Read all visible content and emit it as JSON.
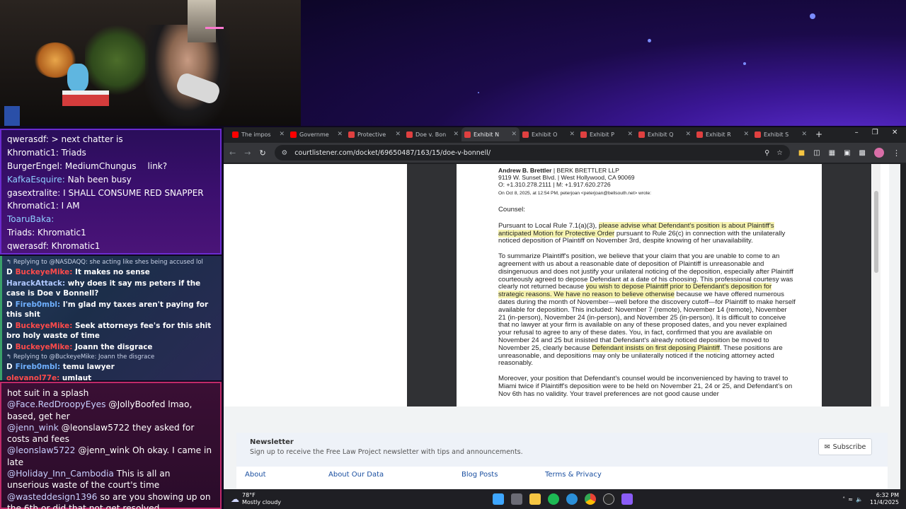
{
  "chat1": {
    "lines": [
      {
        "user": "qwerasdf",
        "text": "> next chatter is",
        "ucolor": "#ffffff"
      },
      {
        "user": "Khromatic1",
        "text": "Triads",
        "ucolor": "#ffffff"
      },
      {
        "user": "BurgerEngel",
        "text": "MediumChungus",
        "extra": "link?",
        "ucolor": "#ffffff"
      },
      {
        "user": "KafkaEsquire",
        "text": "Nah been busy",
        "ucolor": "#8fd0ff"
      },
      {
        "user": "gasextralite",
        "text": "I SHALL CONSUME RED SNAPPER",
        "ucolor": "#ffffff"
      },
      {
        "user": "Khromatic1",
        "text": "I AM",
        "ucolor": "#ffffff"
      },
      {
        "user": "ToaruBaka",
        "text": "",
        "ucolor": "#8fd0ff"
      },
      {
        "user": "Triads",
        "text": "Khromatic1",
        "ucolor": "#ffffff"
      },
      {
        "user": "qwerasdf",
        "text": "Khromatic1",
        "ucolor": "#ffffff"
      }
    ]
  },
  "chat2": {
    "items": [
      {
        "kind": "reply",
        "text": "Replying to @NASDAQQ: she acting like shes being accused lol"
      },
      {
        "kind": "msg",
        "badge": "D",
        "user": "BuckeyeMike",
        "ucolor": "#ff4a4a",
        "text": "It makes no sense"
      },
      {
        "kind": "msg",
        "badge": "",
        "user": "HarackAttack",
        "ucolor": "#b0c8ff",
        "text": "why does it say ms peters if the case is Doe v Bonnell?"
      },
      {
        "kind": "msg",
        "badge": "D",
        "user": "Fireb0mbl",
        "ucolor": "#6fb0ff",
        "text": "I'm glad my taxes aren't paying for this shit"
      },
      {
        "kind": "msg",
        "badge": "D",
        "user": "BuckeyeMike",
        "ucolor": "#ff4a4a",
        "text": "Seek attorneys fee's for this shit bro holy waste of time"
      },
      {
        "kind": "msg",
        "badge": "D",
        "user": "BuckeyeMike",
        "ucolor": "#ff4a4a",
        "text": "Joann the disgrace"
      },
      {
        "kind": "reply",
        "text": "Replying to @BuckeyeMike: Joann the disgrace"
      },
      {
        "kind": "msg",
        "badge": "D",
        "user": "Fireb0mbl",
        "ucolor": "#6fb0ff",
        "text": "temu lawyer"
      },
      {
        "kind": "msg",
        "badge": "",
        "user": "olevanol77e",
        "ucolor": "#ff4a4a",
        "text": "umlaut"
      }
    ]
  },
  "chat3": {
    "lines": [
      {
        "user": "",
        "text": "hot suit in a splash"
      },
      {
        "user": "@Face.RedDroopyEyes",
        "text": "@JollyBoofed lmao, based, get her"
      },
      {
        "user": "@jenn_wink",
        "text": "@leonslaw5722 they asked for costs and fees"
      },
      {
        "user": "@leonslaw5722",
        "text": "@jenn_wink Oh okay. I came in late"
      },
      {
        "user": "@Holiday_Inn_Cambodia",
        "text": "This is all an unserious waste of the court's time"
      },
      {
        "user": "@wasteddesign1396",
        "text": "so are you showing up on the 6th or did that not get resolved"
      }
    ]
  },
  "browser": {
    "tabs": [
      {
        "label": "The impos",
        "icon": "youtube-icon",
        "color": "#ff0000"
      },
      {
        "label": "Governme",
        "icon": "youtube-icon",
        "color": "#ff0000"
      },
      {
        "label": "Protective",
        "icon": "pdf-icon",
        "color": "#e04040"
      },
      {
        "label": "Doe v. Bon",
        "icon": "pdf-icon",
        "color": "#e04040"
      },
      {
        "label": "Exhibit N",
        "icon": "pdf-icon",
        "color": "#e04040",
        "active": true
      },
      {
        "label": "Exhibit O",
        "icon": "pdf-icon",
        "color": "#e04040"
      },
      {
        "label": "Exhibit P",
        "icon": "pdf-icon",
        "color": "#e04040"
      },
      {
        "label": "Exhibit Q",
        "icon": "pdf-icon",
        "color": "#e04040"
      },
      {
        "label": "Exhibit R",
        "icon": "pdf-icon",
        "color": "#e04040"
      },
      {
        "label": "Exhibit S",
        "icon": "pdf-icon",
        "color": "#e04040"
      }
    ],
    "new_tab": "+",
    "url": "courtlistener.com/docket/69650487/163/15/doe-v-bonnell/"
  },
  "document": {
    "sender_name": "Andrew B. Brettler",
    "sender_firm": " | BERK BRETTLER LLP",
    "address": "9119 W. Sunset Blvd. | West Hollywood, CA 90069",
    "phone": "O: +1.310.278.2111 | M: +1.917.620.2726",
    "wrote": "On Oct 8, 2025, at 12:54 PM, peterjoan <peterjoan@bellsouth.net> wrote:",
    "salutation": "Counsel:",
    "p1_a": "Pursuant to Local Rule 7.1(a)(3), ",
    "p1_hl": "please advise what Defendant's position is about Plaintiff's anticipated Motion for Protective Order",
    "p1_b": " pursuant to Rule 26(c) in connection with the unilaterally noticed deposition of Plaintiff on November 3rd, despite knowing of her unavailability.",
    "p2_a": "To summarize Plaintiff's position, we believe that your claim that you are unable to come to an agreement with us about a reasonable date of deposition of Plaintiff is unreasonable and disingenuous and does not justify your unilateral noticing of the deposition, especially after Plaintiff courteously agreed to depose Defendant at a date of his choosing. This professional courtesy was clearly not returned because ",
    "p2_hl": "you wish to depose Plaintiff prior to Defendant's deposition for strategic reasons. We have no reason to believe otherwise",
    "p2_b": " because we have offered numerous dates during the month of November—well before the discovery cutoff—for Plaintiff to make herself available for deposition. This included: November 7 (remote), November 14 (remote), November 21 (in-person), November 24 (in-person), and November 25 (in-person). It is difficult to conceive that no lawyer at your firm is available on any of these proposed dates, and you never explained your refusal to agree to any of these dates. You, in fact, confirmed that you are available on November 24 and 25 but insisted that Defendant's already noticed deposition be moved to November 25, clearly because ",
    "p2_hl2": "Defendant insists on first deposing Plaintiff",
    "p2_c": ". These positions are unreasonable, and depositions may only be unilaterally noticed if the noticing attorney acted reasonably.",
    "p3": "Moreover, your position that Defendant's counsel would be inconvenienced by having to travel to Miami twice if  Plaintiff's deposition were to be held on November 21, 24 or 25, and Defendant's on Nov 6th has no validity. Your travel preferences are not good cause under"
  },
  "newsletter": {
    "title": "Newsletter",
    "text": "Sign up to receive the Free Law Project newsletter with tips and announcements.",
    "button": "Subscribe"
  },
  "footer": {
    "links": [
      "About",
      "About Our Data",
      "Blog Posts",
      "Terms & Privacy"
    ]
  },
  "taskbar": {
    "temp": "78°F",
    "weather": "Mostly cloudy",
    "time": "6:32 PM",
    "date": "11/4/2025"
  }
}
